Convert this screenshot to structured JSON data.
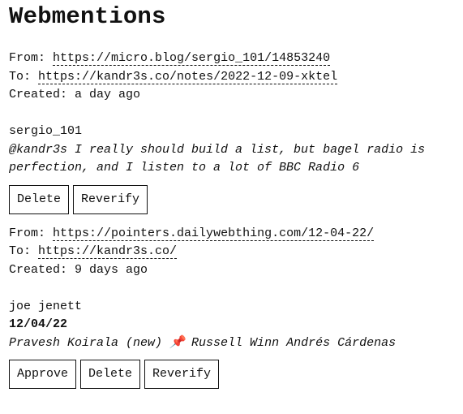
{
  "page": {
    "title": "Webmentions"
  },
  "labels": {
    "from": "From:",
    "to": "To:",
    "created": "Created:"
  },
  "mentions": [
    {
      "from_url": "https://micro.blog/sergio_101/14853240",
      "to_url": "https://kandr3s.co/notes/2022-12-09-xktel",
      "created": "a day ago",
      "author": "sergio_101",
      "content_line_1": "@kandr3s I really should build a list, but bagel radio is",
      "content_line_2": "perfection, and I listen to a lot of BBC Radio 6",
      "actions": {
        "delete": "Delete",
        "reverify": "Reverify"
      }
    },
    {
      "from_url": "https://pointers.dailywebthing.com/12-04-22/",
      "to_url": "https://kandr3s.co/",
      "created": "9 days ago",
      "author": "joe jenett",
      "date": "12/04/22",
      "content_before_pin": "Pravesh Koirala (new) ",
      "pin_icon": "pushpin-icon",
      "pin_glyph": "📌",
      "content_after_pin": " Russell Winn Andrés Cárdenas",
      "actions": {
        "approve": "Approve",
        "delete": "Delete",
        "reverify": "Reverify"
      }
    }
  ]
}
